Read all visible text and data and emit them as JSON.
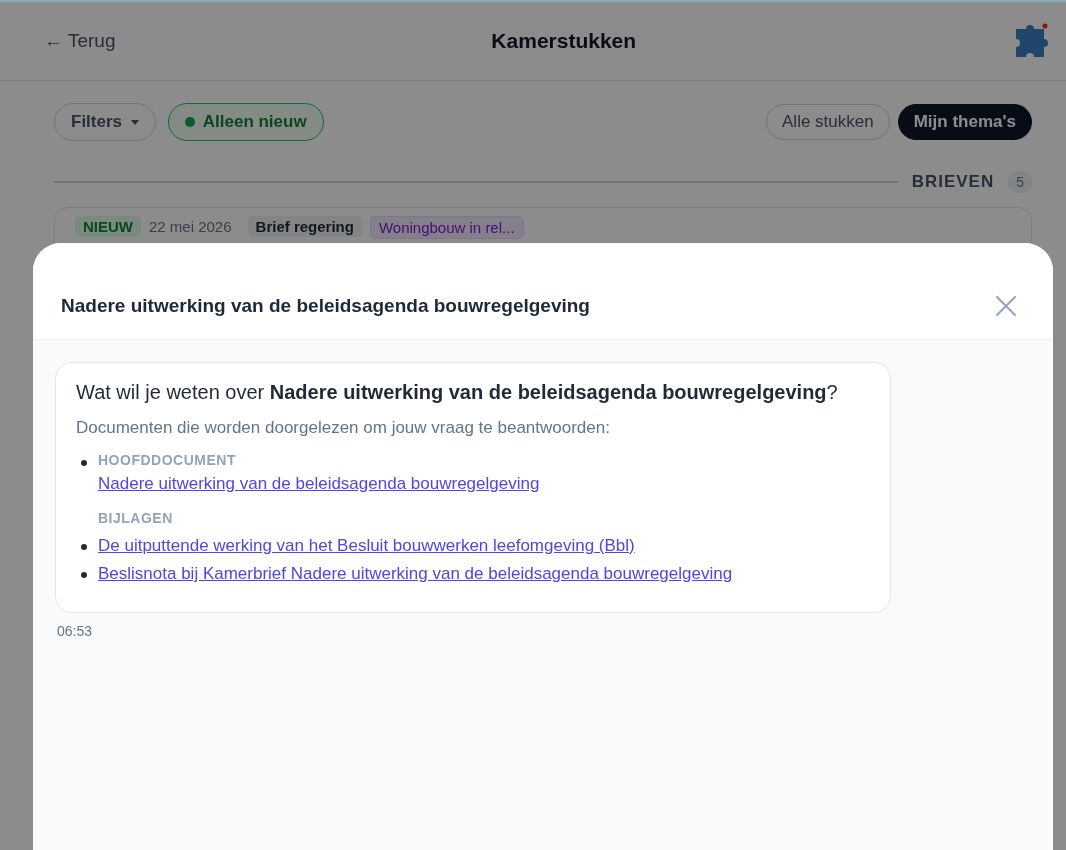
{
  "header": {
    "back": "← Terug",
    "title": "Kamerstukken"
  },
  "filters": {
    "filters_button": "Filters",
    "only_new": {
      "label": "Alleen nieuw",
      "on": true
    },
    "scope_tabs": [
      {
        "label": "Alle stukken",
        "selected": false
      },
      {
        "label": "Mijn thema's",
        "selected": true
      }
    ]
  },
  "section": {
    "title": "BRIEVEN",
    "count": "5"
  },
  "card": {
    "badge": "NIEUW",
    "date": "22 mei 2026",
    "type": "Brief regering",
    "theme": "Woningbouw in rel..."
  },
  "sheet": {
    "title": "Nadere uitwerking van de beleidsagenda bouwregelgeving",
    "message": {
      "question": "Wat wil je weten over **Nadere uitwerking van de beleidsagenda bouwregelgeving**?",
      "intro": "Documenten die worden doorgelezen om jouw vraag te beantwoorden:",
      "main_label": "HOOFDDOCUMENT",
      "main_document": "Nadere uitwerking van de beleidsagenda bouwregelgeving",
      "attachments_label": "BIJLAGEN",
      "attachments": [
        "De uitputtende werking van het Besluit bouwwerken leefomgeving (Bbl)",
        "Beslisnota bij Kamerbrief Nadere uitwerking van de beleidsagenda bouwregelgeving"
      ],
      "time": "06:53"
    }
  }
}
